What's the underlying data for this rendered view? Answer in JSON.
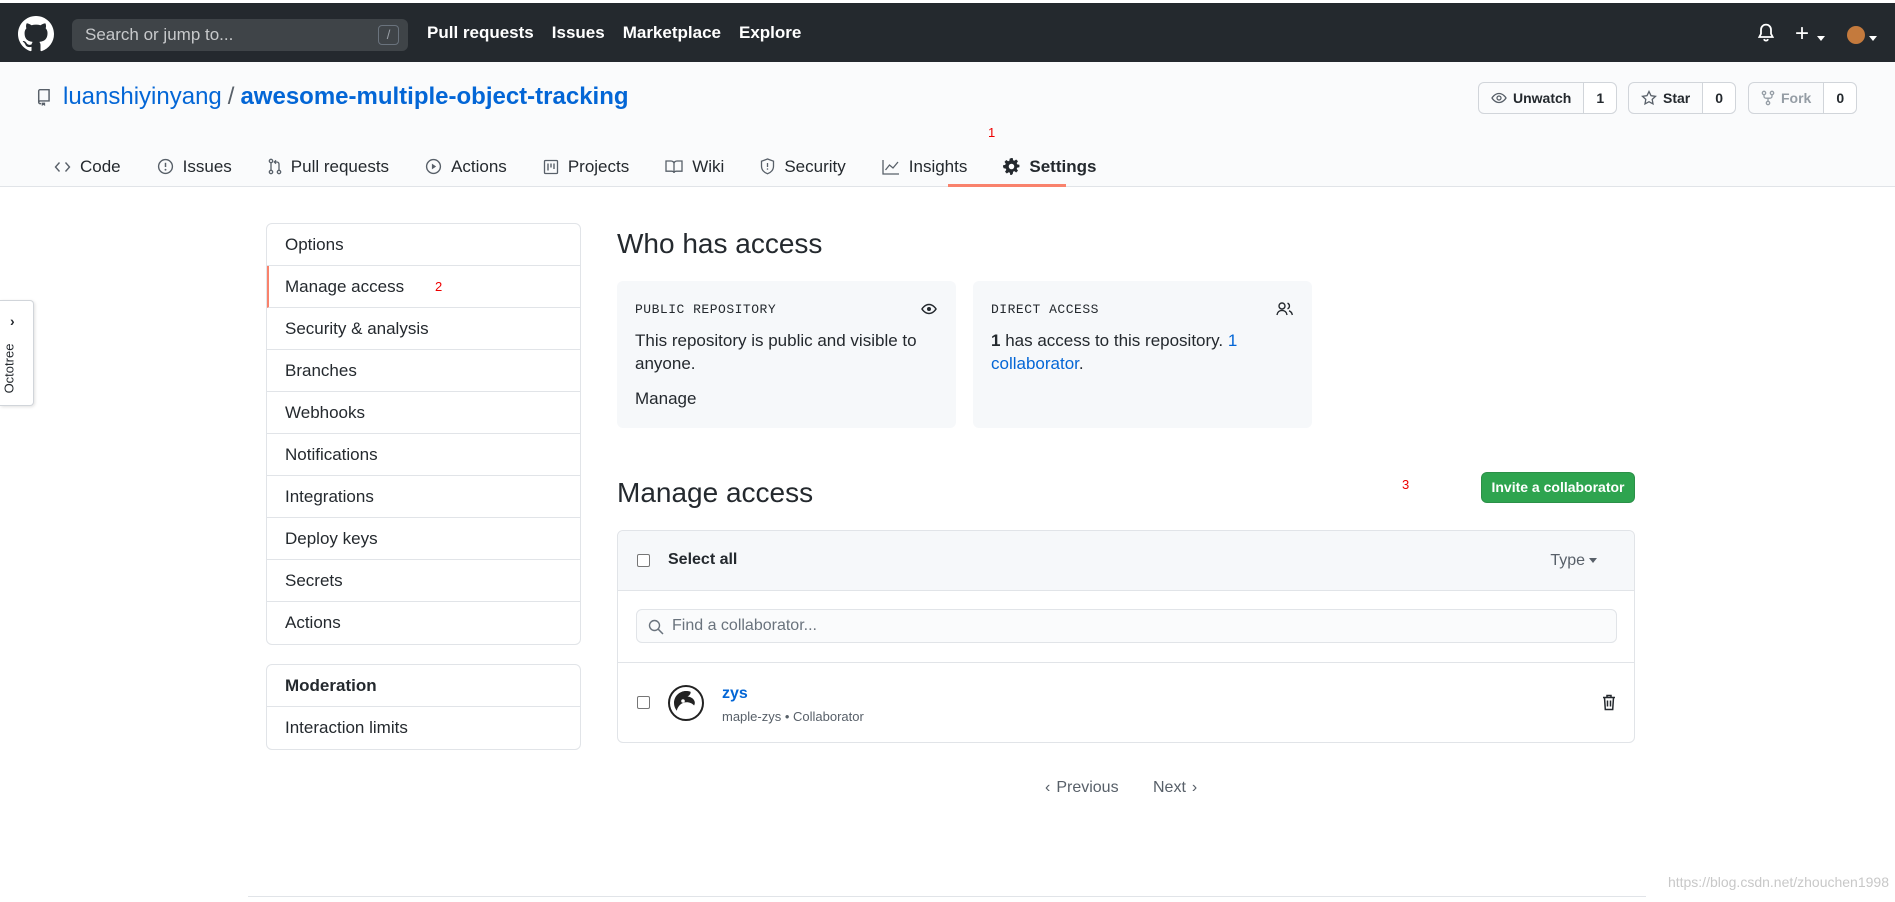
{
  "topbar": {
    "search_placeholder": "Search or jump to...",
    "search_shortcut": "/",
    "nav": [
      "Pull requests",
      "Issues",
      "Marketplace",
      "Explore"
    ],
    "icons": [
      "github-logo-icon",
      "bell-icon",
      "plus-icon",
      "avatar"
    ]
  },
  "repo": {
    "owner": "luanshiyinyang",
    "separator": "/",
    "name": "awesome-multiple-object-tracking",
    "watch_label": "Unwatch",
    "watch_count": "1",
    "star_label": "Star",
    "star_count": "0",
    "fork_label": "Fork",
    "fork_count": "0"
  },
  "tabs": [
    {
      "label": "Code",
      "icon": "code-icon"
    },
    {
      "label": "Issues",
      "icon": "issue-icon"
    },
    {
      "label": "Pull requests",
      "icon": "pull-request-icon"
    },
    {
      "label": "Actions",
      "icon": "play-icon"
    },
    {
      "label": "Projects",
      "icon": "project-icon"
    },
    {
      "label": "Wiki",
      "icon": "book-icon"
    },
    {
      "label": "Security",
      "icon": "shield-icon"
    },
    {
      "label": "Insights",
      "icon": "graph-icon"
    },
    {
      "label": "Settings",
      "icon": "gear-icon",
      "selected": true
    }
  ],
  "annotations": {
    "one": "1",
    "two": "2",
    "three": "3"
  },
  "octotree": {
    "label": "Octotree"
  },
  "sidebar": {
    "items": [
      "Options",
      "Manage access",
      "Security & analysis",
      "Branches",
      "Webhooks",
      "Notifications",
      "Integrations",
      "Deploy keys",
      "Secrets",
      "Actions"
    ],
    "selected": "Manage access",
    "moderation_title": "Moderation",
    "moderation_items": [
      "Interaction limits"
    ]
  },
  "who": {
    "title": "Who has access",
    "public_kicker": "PUBLIC REPOSITORY",
    "public_text": "This repository is public and visible to anyone.",
    "manage_link": "Manage",
    "direct_kicker": "DIRECT ACCESS",
    "direct_count": "1",
    "direct_text": " has access to this repository. ",
    "direct_link": "1 collaborator",
    "direct_end": "."
  },
  "manage": {
    "title": "Manage access",
    "invite_label": "Invite a collaborator",
    "select_all": "Select all",
    "type_label": "Type",
    "find_placeholder": "Find a collaborator...",
    "collaborators": [
      {
        "name": "zys",
        "meta": "maple-zys • Collaborator"
      }
    ],
    "prev_label": "Previous",
    "next_label": "Next"
  },
  "watermark": "https://blog.csdn.net/zhouchen1998",
  "colors": {
    "header_bg": "#24292e",
    "link": "#0366d6",
    "accent": "#f9826c",
    "invite_green": "#2ea44f"
  }
}
